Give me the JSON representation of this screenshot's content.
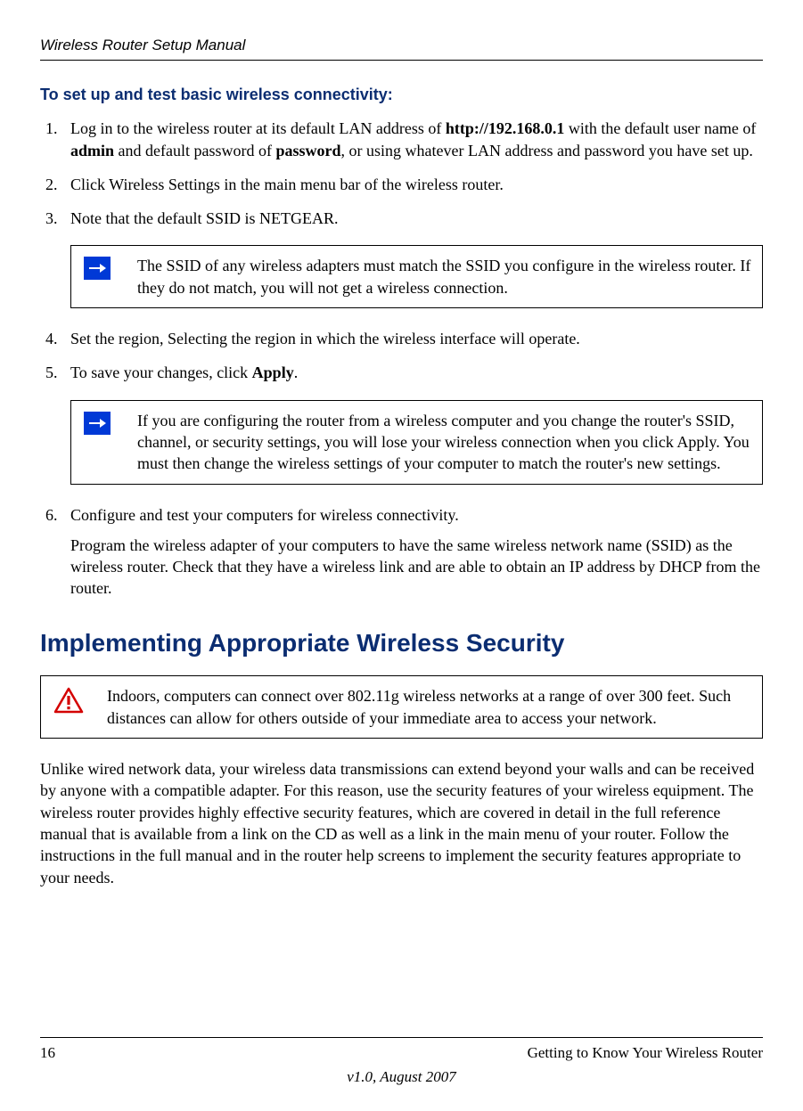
{
  "header": {
    "manual_title": "Wireless Router Setup Manual"
  },
  "section": {
    "heading": "To set up and test basic wireless connectivity:"
  },
  "steps": {
    "s1_pre": "Log in to the wireless router at its default LAN address of ",
    "s1_url": "http://192.168.0.1",
    "s1_mid1": " with the default user name of ",
    "s1_admin": "admin",
    "s1_mid2": " and default password of ",
    "s1_pw": "password",
    "s1_post": ", or using whatever LAN address and password you have set up.",
    "s2": "Click Wireless Settings in the main menu bar of the wireless router.",
    "s3": "Note that the default SSID is NETGEAR.",
    "s4": "Set the region, Selecting the region in which the wireless interface will operate.",
    "s5_pre": "To save your changes, click ",
    "s5_apply": "Apply",
    "s5_post": ".",
    "s6": "Configure and test your computers for wireless connectivity.",
    "s6_para": "Program the wireless adapter of your computers to have the same wireless network name (SSID) as the wireless router. Check that they have a wireless link and are able to obtain an IP address by DHCP from the router."
  },
  "notes": {
    "note1": "The SSID of any wireless adapters must match the SSID you configure in the wireless router. If they do not match, you will not get a wireless connection.",
    "note2": "If you are configuring the router from a wireless computer and you change the router's SSID, channel, or security settings, you will lose your wireless connection when you click Apply. You must then change the wireless settings of your computer to match the router's new settings.",
    "warning": "Indoors, computers can connect over 802.11g wireless networks at a range of over 300 feet. Such distances can allow for others outside of your immediate area to access your network."
  },
  "h1": "Implementing Appropriate Wireless Security",
  "body_para": "Unlike wired network data, your wireless data transmissions can extend beyond your walls and can be received by anyone with a compatible adapter. For this reason, use the security features of your wireless equipment. The wireless router provides highly effective security features, which are covered in detail in the full reference manual that is available from a link on the CD as well as a link in the main menu of your router. Follow the instructions in the full manual and in the router help screens to implement the security features appropriate to your needs.",
  "footer": {
    "page": "16",
    "right": "Getting to Know Your Wireless Router",
    "center": "v1.0, August 2007"
  }
}
